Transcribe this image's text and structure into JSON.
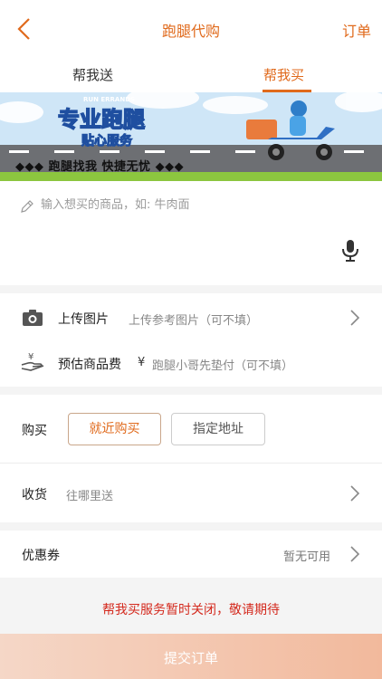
{
  "nav": {
    "title": "跑腿代购",
    "right_action": "订单"
  },
  "tabs": [
    {
      "label": "帮我送"
    },
    {
      "label": "帮我买"
    }
  ],
  "banner": {
    "badge": "RUN ERRANDS",
    "headline": "专业跑腿",
    "subline": "贴心服务",
    "slogan": "◆◆◆ 跑腿找我  快捷无忧 ◆◆◆"
  },
  "goods": {
    "placeholder": "输入想买的商品，如: 牛肉面"
  },
  "upload": {
    "label": "上传图片",
    "hint": "上传参考图片（可不填）"
  },
  "estimate": {
    "label": "预估商品费",
    "currency": "¥",
    "hint": "跑腿小哥先垫付（可不填）"
  },
  "buy": {
    "label": "购买",
    "options": [
      {
        "label": "就近购买"
      },
      {
        "label": "指定地址"
      }
    ]
  },
  "delivery": {
    "label": "收货",
    "hint": "往哪里送"
  },
  "coupon": {
    "label": "优惠券",
    "value": "暂无可用"
  },
  "notice": "帮我买服务暂时关闭，敬请期待",
  "submit": {
    "label": "提交订单"
  },
  "colors": {
    "accent": "#e06a1c",
    "notice": "#d42a1e"
  }
}
